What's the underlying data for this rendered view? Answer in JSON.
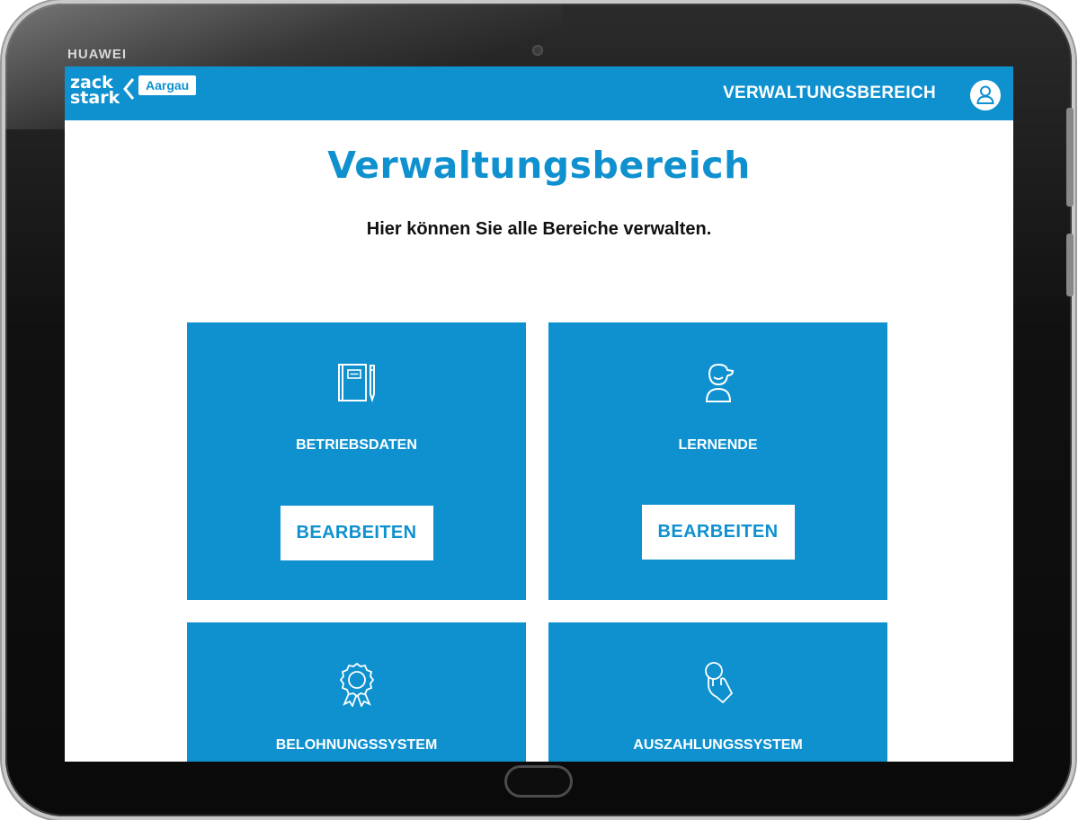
{
  "device": {
    "brand": "HUAWEI"
  },
  "header": {
    "logo_line1": "zack",
    "logo_line2": "stark",
    "logo_badge": "Aargau",
    "nav_link": "VERWALTUNGSBEREICH",
    "profile_icon": "user-profile-icon"
  },
  "main": {
    "title": "Verwaltungsbereich",
    "subtitle": "Hier können Sie alle Bereiche verwalten."
  },
  "cards": [
    {
      "label": "BETRIEBSDATEN",
      "button": "BEARBEITEN",
      "icon": "notebook-pencil-icon"
    },
    {
      "label": "LERNENDE",
      "button": "BEARBEITEN",
      "icon": "student-cap-icon"
    },
    {
      "label": "BELOHNUNGSSYSTEM",
      "button": "",
      "icon": "award-rosette-icon"
    },
    {
      "label": "AUSZAHLUNGSSYSTEM",
      "button": "",
      "icon": "hand-coin-icon"
    }
  ],
  "colors": {
    "accent": "#0f91cf",
    "background": "#ffffff",
    "text": "#111111"
  }
}
